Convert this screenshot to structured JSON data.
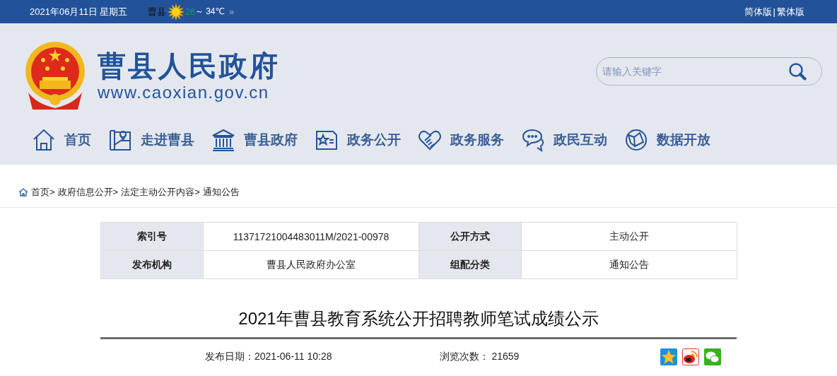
{
  "top_bar": {
    "date": "2021年06月11日 星期五",
    "weather": {
      "city": "曹县",
      "low": "26",
      "separator": "～",
      "high": "34℃",
      "more": "»"
    },
    "versions": [
      {
        "label": "简体版",
        "kind": "link"
      },
      {
        "label": "|",
        "kind": "divider"
      },
      {
        "label": "繁体版",
        "kind": "link"
      }
    ]
  },
  "header": {
    "site_name": "曹县人民政府",
    "site_url": "www.caoxian.gov.cn",
    "search": {
      "placeholder": "请输入关键字"
    }
  },
  "nav": [
    {
      "label": "首页",
      "kind": "home"
    },
    {
      "label": "走进曹县",
      "kind": "map"
    },
    {
      "label": "曹县政府",
      "kind": "building"
    },
    {
      "label": "政务公开",
      "kind": "card"
    },
    {
      "label": "政务服务",
      "kind": "handshake"
    },
    {
      "label": "政民互动",
      "kind": "chat"
    },
    {
      "label": "数据开放",
      "kind": "globe"
    }
  ],
  "breadcrumb": [
    "首页>",
    "政府信息公开>",
    "法定主动公开内容>",
    "通知公告"
  ],
  "info_table": [
    [
      {
        "label": "索引号",
        "value": "11371721004483011M/2021-00978"
      },
      {
        "label": "公开方式",
        "value": "主动公开"
      }
    ],
    [
      {
        "label": "发布机构",
        "value": "曹县人民政府办公室"
      },
      {
        "label": "组配分类",
        "value": "通知公告"
      }
    ]
  ],
  "article": {
    "title": "2021年曹县教育系统公开招聘教师笔试成绩公示",
    "publish_date": "发布日期：2021-06-11 10:28",
    "views": "浏览次数： 21659"
  }
}
